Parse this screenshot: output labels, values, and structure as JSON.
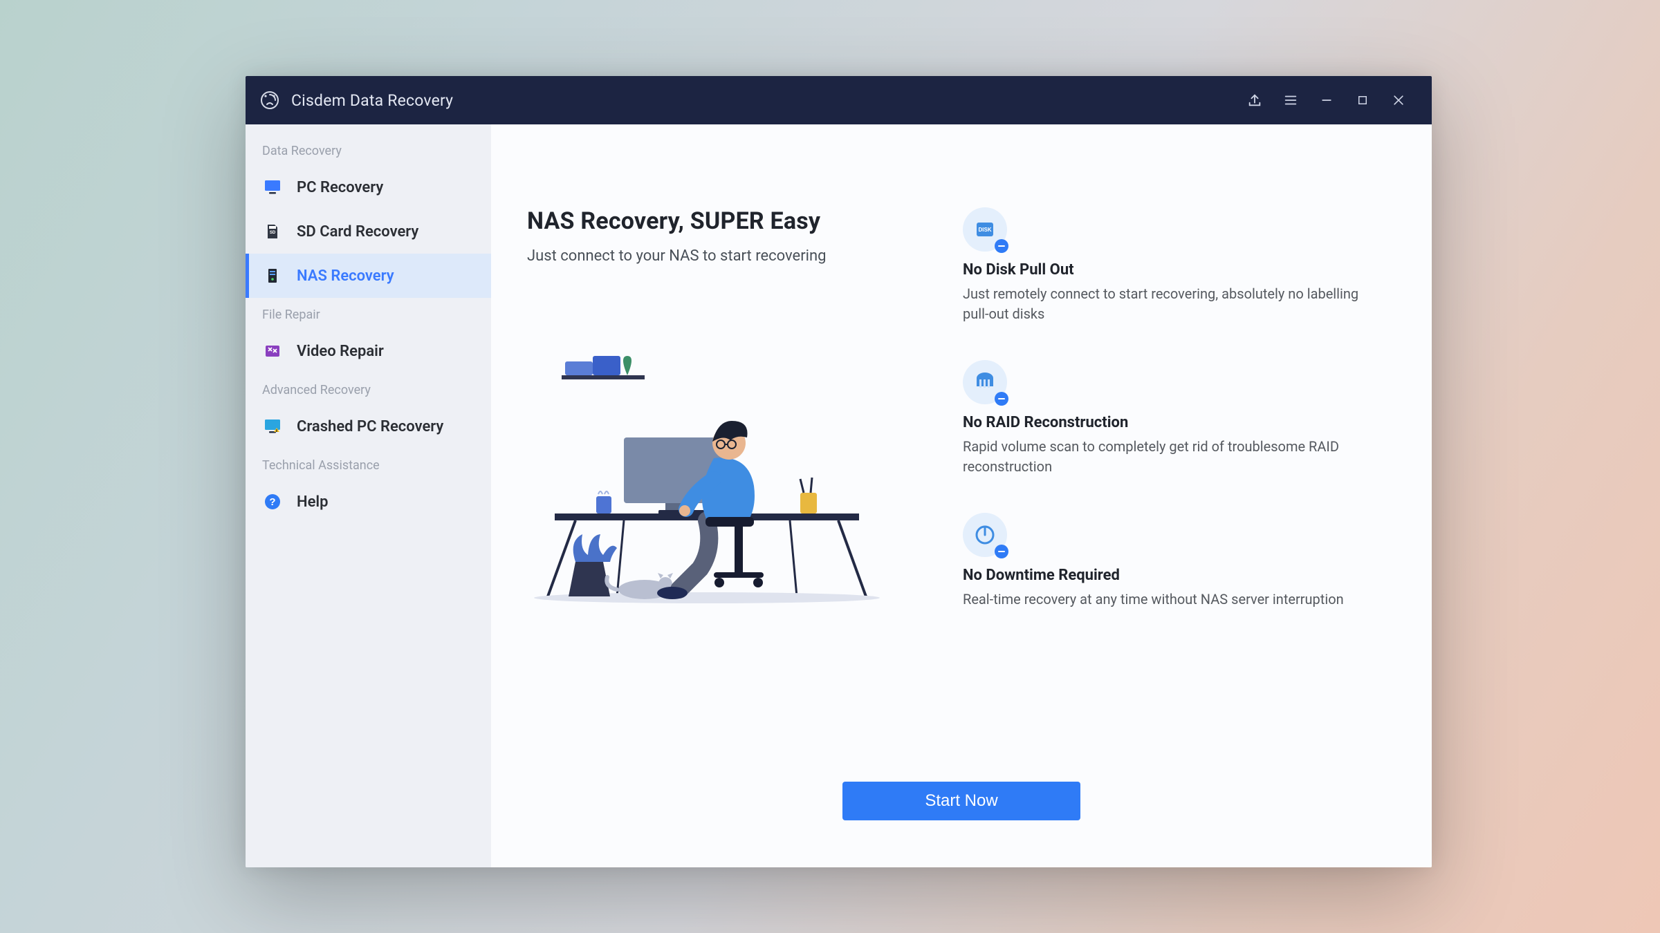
{
  "titlebar": {
    "app_title": "Cisdem Data Recovery"
  },
  "sidebar": {
    "sections": {
      "data_recovery": {
        "label": "Data Recovery"
      },
      "file_repair": {
        "label": "File Repair"
      },
      "advanced_recovery": {
        "label": "Advanced Recovery"
      },
      "technical_assistance": {
        "label": "Technical Assistance"
      }
    },
    "items": {
      "pc_recovery": {
        "label": "PC Recovery"
      },
      "sd_card_recovery": {
        "label": "SD Card Recovery"
      },
      "nas_recovery": {
        "label": "NAS Recovery"
      },
      "video_repair": {
        "label": "Video Repair"
      },
      "crashed_pc_recovery": {
        "label": "Crashed PC Recovery"
      },
      "help": {
        "label": "Help"
      }
    },
    "active": "nas_recovery"
  },
  "main": {
    "title": "NAS Recovery, SUPER Easy",
    "subtitle": "Just connect to your NAS to start recovering",
    "features": [
      {
        "title": "No Disk Pull Out",
        "desc": "Just remotely connect to start recovering, absolutely no labelling pull-out disks"
      },
      {
        "title": "No RAID Reconstruction",
        "desc": "Rapid volume scan to completely get rid of troublesome RAID reconstruction"
      },
      {
        "title": "No Downtime Required",
        "desc": "Real-time recovery at any time without NAS server interruption"
      }
    ],
    "cta_label": "Start Now"
  },
  "colors": {
    "accent": "#2f7bf6",
    "titlebar_bg": "#1c2442",
    "sidebar_bg": "#eef0f5"
  }
}
